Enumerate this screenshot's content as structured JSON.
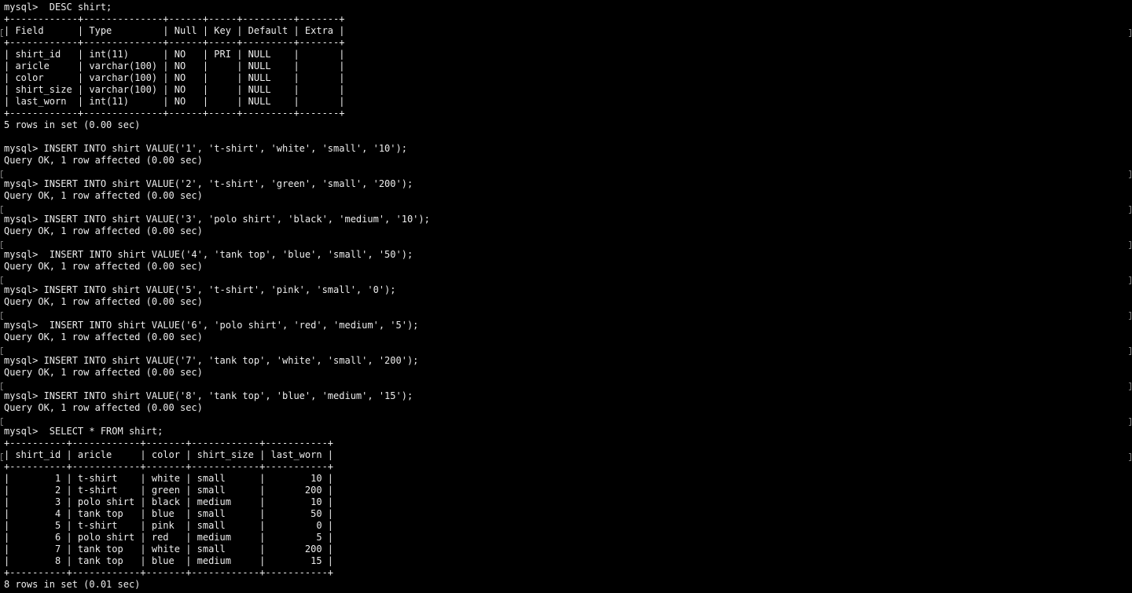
{
  "terminal": {
    "colors": {
      "background": "#000000",
      "text": "#ededed",
      "margin_marker": "#7a7a7a"
    },
    "lines": [
      "mysql>  DESC shirt;",
      "+------------+--------------+------+-----+---------+-------+",
      "| Field      | Type         | Null | Key | Default | Extra |",
      "+------------+--------------+------+-----+---------+-------+",
      "| shirt_id   | int(11)      | NO   | PRI | NULL    |       |",
      "| aricle     | varchar(100) | NO   |     | NULL    |       |",
      "| color      | varchar(100) | NO   |     | NULL    |       |",
      "| shirt_size | varchar(100) | NO   |     | NULL    |       |",
      "| last_worn  | int(11)      | NO   |     | NULL    |       |",
      "+------------+--------------+------+-----+---------+-------+",
      "5 rows in set (0.00 sec)",
      "",
      "mysql> INSERT INTO shirt VALUE('1', 't-shirt', 'white', 'small', '10');",
      "Query OK, 1 row affected (0.00 sec)",
      "",
      "mysql> INSERT INTO shirt VALUE('2', 't-shirt', 'green', 'small', '200');",
      "Query OK, 1 row affected (0.00 sec)",
      "",
      "mysql> INSERT INTO shirt VALUE('3', 'polo shirt', 'black', 'medium', '10');",
      "Query OK, 1 row affected (0.00 sec)",
      "",
      "mysql>  INSERT INTO shirt VALUE('4', 'tank top', 'blue', 'small', '50');",
      "Query OK, 1 row affected (0.00 sec)",
      "",
      "mysql> INSERT INTO shirt VALUE('5', 't-shirt', 'pink', 'small', '0');",
      "Query OK, 1 row affected (0.00 sec)",
      "",
      "mysql>  INSERT INTO shirt VALUE('6', 'polo shirt', 'red', 'medium', '5');",
      "Query OK, 1 row affected (0.00 sec)",
      "",
      "mysql> INSERT INTO shirt VALUE('7', 'tank top', 'white', 'small', '200');",
      "Query OK, 1 row affected (0.00 sec)",
      "",
      "mysql> INSERT INTO shirt VALUE('8', 'tank top', 'blue', 'medium', '15');",
      "Query OK, 1 row affected (0.00 sec)",
      "",
      "mysql>  SELECT * FROM shirt;",
      "+----------+------------+-------+------------+-----------+",
      "| shirt_id | aricle     | color | shirt_size | last_worn |",
      "+----------+------------+-------+------------+-----------+",
      "|        1 | t-shirt    | white | small      |        10 |",
      "|        2 | t-shirt    | green | small      |       200 |",
      "|        3 | polo shirt | black | medium     |        10 |",
      "|        4 | tank top   | blue  | small      |        50 |",
      "|        5 | t-shirt    | pink  | small      |         0 |",
      "|        6 | polo shirt | red   | medium     |         5 |",
      "|        7 | tank top   | white | small      |       200 |",
      "|        8 | tank top   | blue  | medium     |        15 |",
      "+----------+------------+-------+------------+-----------+",
      "8 rows in set (0.01 sec)"
    ]
  }
}
